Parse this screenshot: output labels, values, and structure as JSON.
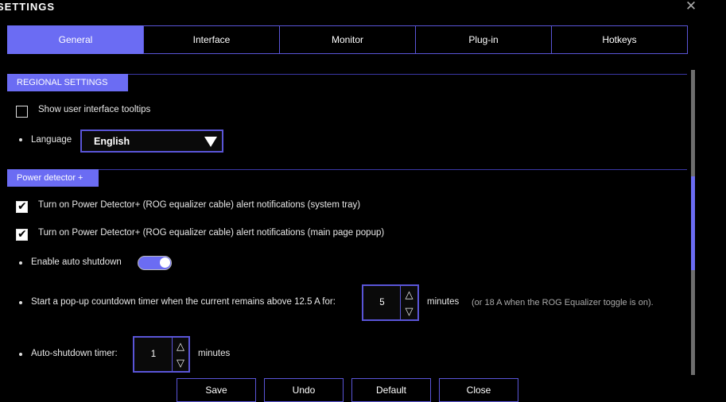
{
  "window": {
    "title": "SETTINGS",
    "close_icon": "✕"
  },
  "tabs": [
    {
      "label": "General",
      "active": true
    },
    {
      "label": "Interface",
      "active": false
    },
    {
      "label": "Monitor",
      "active": false
    },
    {
      "label": "Plug-in",
      "active": false
    },
    {
      "label": "Hotkeys",
      "active": false
    }
  ],
  "regional": {
    "header": "REGIONAL SETTINGS",
    "tooltips_label": "Show user interface tooltips",
    "tooltips_checked": false,
    "language_label": "Language",
    "language_value": "English"
  },
  "power": {
    "header": "Power detector +",
    "notify_tray_label": "Turn on Power Detector+ (ROG equalizer cable) alert notifications (system tray)",
    "notify_tray_checked": true,
    "notify_popup_label": "Turn on Power Detector+ (ROG equalizer cable) alert notifications (main page popup)",
    "notify_popup_checked": true,
    "auto_shutdown_label": "Enable auto shutdown",
    "auto_shutdown_on": true,
    "countdown_label": "Start a pop-up countdown timer when the current remains above 12.5 A for:",
    "countdown_value": "5",
    "countdown_unit": "minutes",
    "countdown_note": "(or 18 A when the ROG Equalizer toggle is on).",
    "shutdown_timer_label": "Auto-shutdown timer:",
    "shutdown_timer_value": "1",
    "shutdown_timer_unit": "minutes"
  },
  "buttons": {
    "save": "Save",
    "undo": "Undo",
    "default": "Default",
    "close": "Close"
  },
  "colors": {
    "accent": "#6b6cf3",
    "border": "#5a55d8",
    "background": "#000000"
  }
}
